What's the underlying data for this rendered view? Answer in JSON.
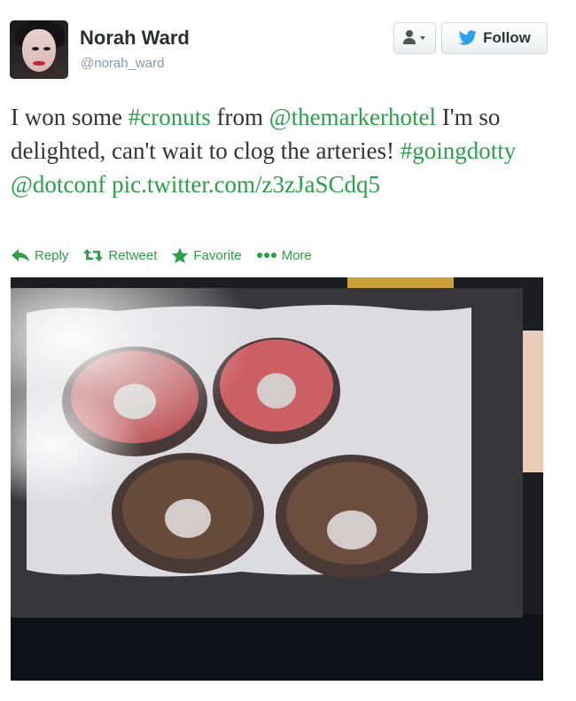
{
  "user": {
    "display_name": "Norah Ward",
    "handle": "@norah_ward"
  },
  "header_actions": {
    "user_menu_icon": "user-dropdown-icon",
    "follow_label": "Follow"
  },
  "tweet": {
    "segments": [
      {
        "text": "I won some ",
        "highlight": false
      },
      {
        "text": "#cronuts",
        "highlight": true
      },
      {
        "text": " from ",
        "highlight": false
      },
      {
        "text": "@themarkerhotel",
        "highlight": true
      },
      {
        "text": " I'm so delighted, can't wait to clog the arteries! ",
        "highlight": false
      },
      {
        "text": "#goingdotty",
        "highlight": true
      },
      {
        "text": " ",
        "highlight": false
      },
      {
        "text": "@dotconf",
        "highlight": true
      },
      {
        "text": " ",
        "highlight": false
      },
      {
        "text": "pic.twitter.com/z3zJaSCdq5",
        "highlight": true
      }
    ]
  },
  "actions": {
    "reply": "Reply",
    "retweet": "Retweet",
    "favorite": "Favorite",
    "more": "More"
  },
  "colors": {
    "accent": "#2aa047",
    "twitter_blue": "#2aa3ef"
  }
}
